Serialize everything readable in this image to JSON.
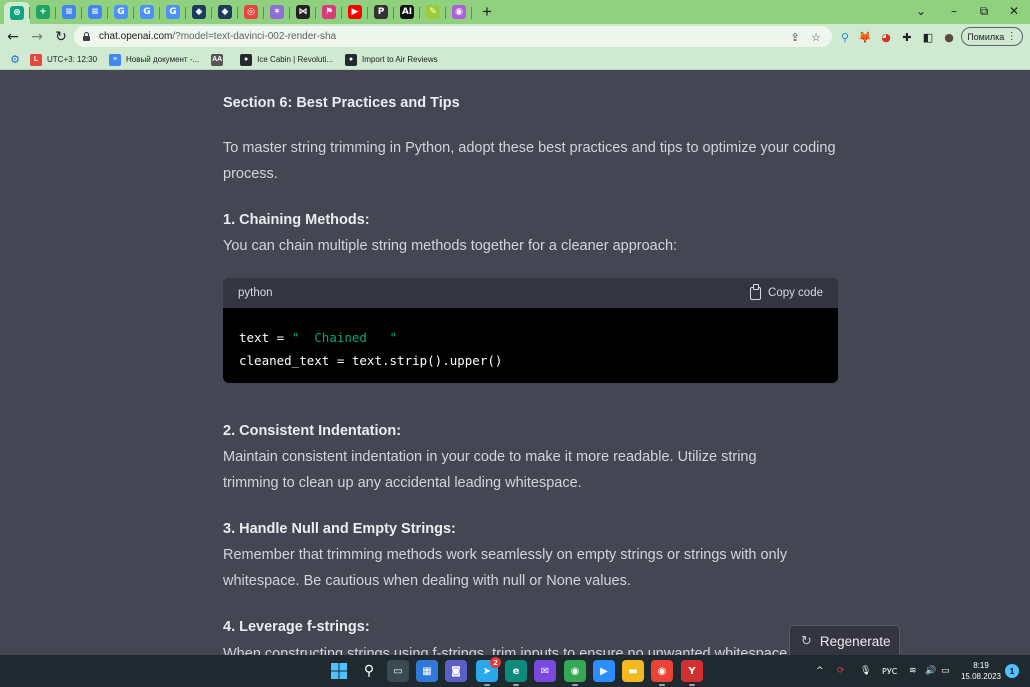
{
  "browser": {
    "tabs": [
      {
        "icon": "chatgpt-icon",
        "color": "#10a37f",
        "glyph": "⊛"
      },
      {
        "icon": "sheets-icon",
        "color": "#1fa463",
        "glyph": "+"
      },
      {
        "icon": "docs-icon",
        "color": "#4285f4",
        "glyph": "≡"
      },
      {
        "icon": "docs-icon",
        "color": "#4285f4",
        "glyph": "≡"
      },
      {
        "icon": "translate-icon",
        "color": "#4d90fe",
        "glyph": "G"
      },
      {
        "icon": "translate-icon",
        "color": "#4d90fe",
        "glyph": "G"
      },
      {
        "icon": "translate-icon",
        "color": "#4d90fe",
        "glyph": "G"
      },
      {
        "icon": "shield-icon",
        "color": "#1b3a5c",
        "glyph": "◆"
      },
      {
        "icon": "shield-icon",
        "color": "#1b3a5c",
        "glyph": "◆"
      },
      {
        "icon": "target-icon",
        "color": "#e8453c",
        "glyph": "◎"
      },
      {
        "icon": "spark-icon",
        "color": "#8e6fd8",
        "glyph": "✶"
      },
      {
        "icon": "bowtie-icon",
        "color": "#222222",
        "glyph": "⋈"
      },
      {
        "icon": "flag-icon",
        "color": "#d93a7b",
        "glyph": "⚑"
      },
      {
        "icon": "youtube-icon",
        "color": "#ff0000",
        "glyph": "▶"
      },
      {
        "icon": "p-icon",
        "color": "#333333",
        "glyph": "P"
      },
      {
        "icon": "ai-icon",
        "color": "#111111",
        "glyph": "AI"
      },
      {
        "icon": "leaf-icon",
        "color": "#9ccc3c",
        "glyph": "✎"
      },
      {
        "icon": "circle-icon",
        "color": "#b05fd8",
        "glyph": "◉"
      }
    ],
    "url_host": "chat.openai.com",
    "url_path": "/?model=text-davinci-002-render-sha",
    "profile_label": "Помилка",
    "bookmarks": [
      {
        "label": "UTC+3: 12:30",
        "icon": "clock-icon",
        "color": "#e8453c",
        "glyph": "L"
      },
      {
        "label": "Новый документ -...",
        "icon": "docs-icon",
        "color": "#4285f4",
        "glyph": "≡"
      },
      {
        "label": "",
        "icon": "aa-icon",
        "color": "#555555",
        "glyph": "AA"
      },
      {
        "label": "Ice Cabin | Revoluti...",
        "icon": "github-icon",
        "color": "#24292e",
        "glyph": "●"
      },
      {
        "label": "Import to Air Reviews",
        "icon": "github-icon",
        "color": "#24292e",
        "glyph": "●"
      }
    ]
  },
  "article": {
    "section_title": "Section 6: Best Practices and Tips",
    "intro": "To master string trimming in Python, adopt these best practices and tips to optimize your coding process.",
    "tip1_title": "1. Chaining Methods:",
    "tip1_text": "You can chain multiple string methods together for a cleaner approach:",
    "code_lang": "python",
    "copy_label": "Copy code",
    "code_line1_a": "text = ",
    "code_line1_str": "\"  Chained   \"",
    "code_line2": "cleaned_text = text.strip().upper()",
    "tip2_title": "2. Consistent Indentation:",
    "tip2_text": "Maintain consistent indentation in your code to make it more readable. Utilize string trimming to clean up any accidental leading whitespace.",
    "tip3_title": "3. Handle Null and Empty Strings:",
    "tip3_text": "Remember that trimming methods work seamlessly on empty strings or strings with only whitespace. Be cautious when dealing with null or None values.",
    "tip4_title": "4. Leverage f-strings:",
    "tip4_text": "When constructing strings using f-strings, trim inputs to ensure no unwanted whitespace"
  },
  "regenerate_label": "Regenerate",
  "taskbar": {
    "lang": "РУС",
    "time": "8:19",
    "date": "15.08.2023",
    "notification_count": "1",
    "telegram_badge": "2"
  }
}
